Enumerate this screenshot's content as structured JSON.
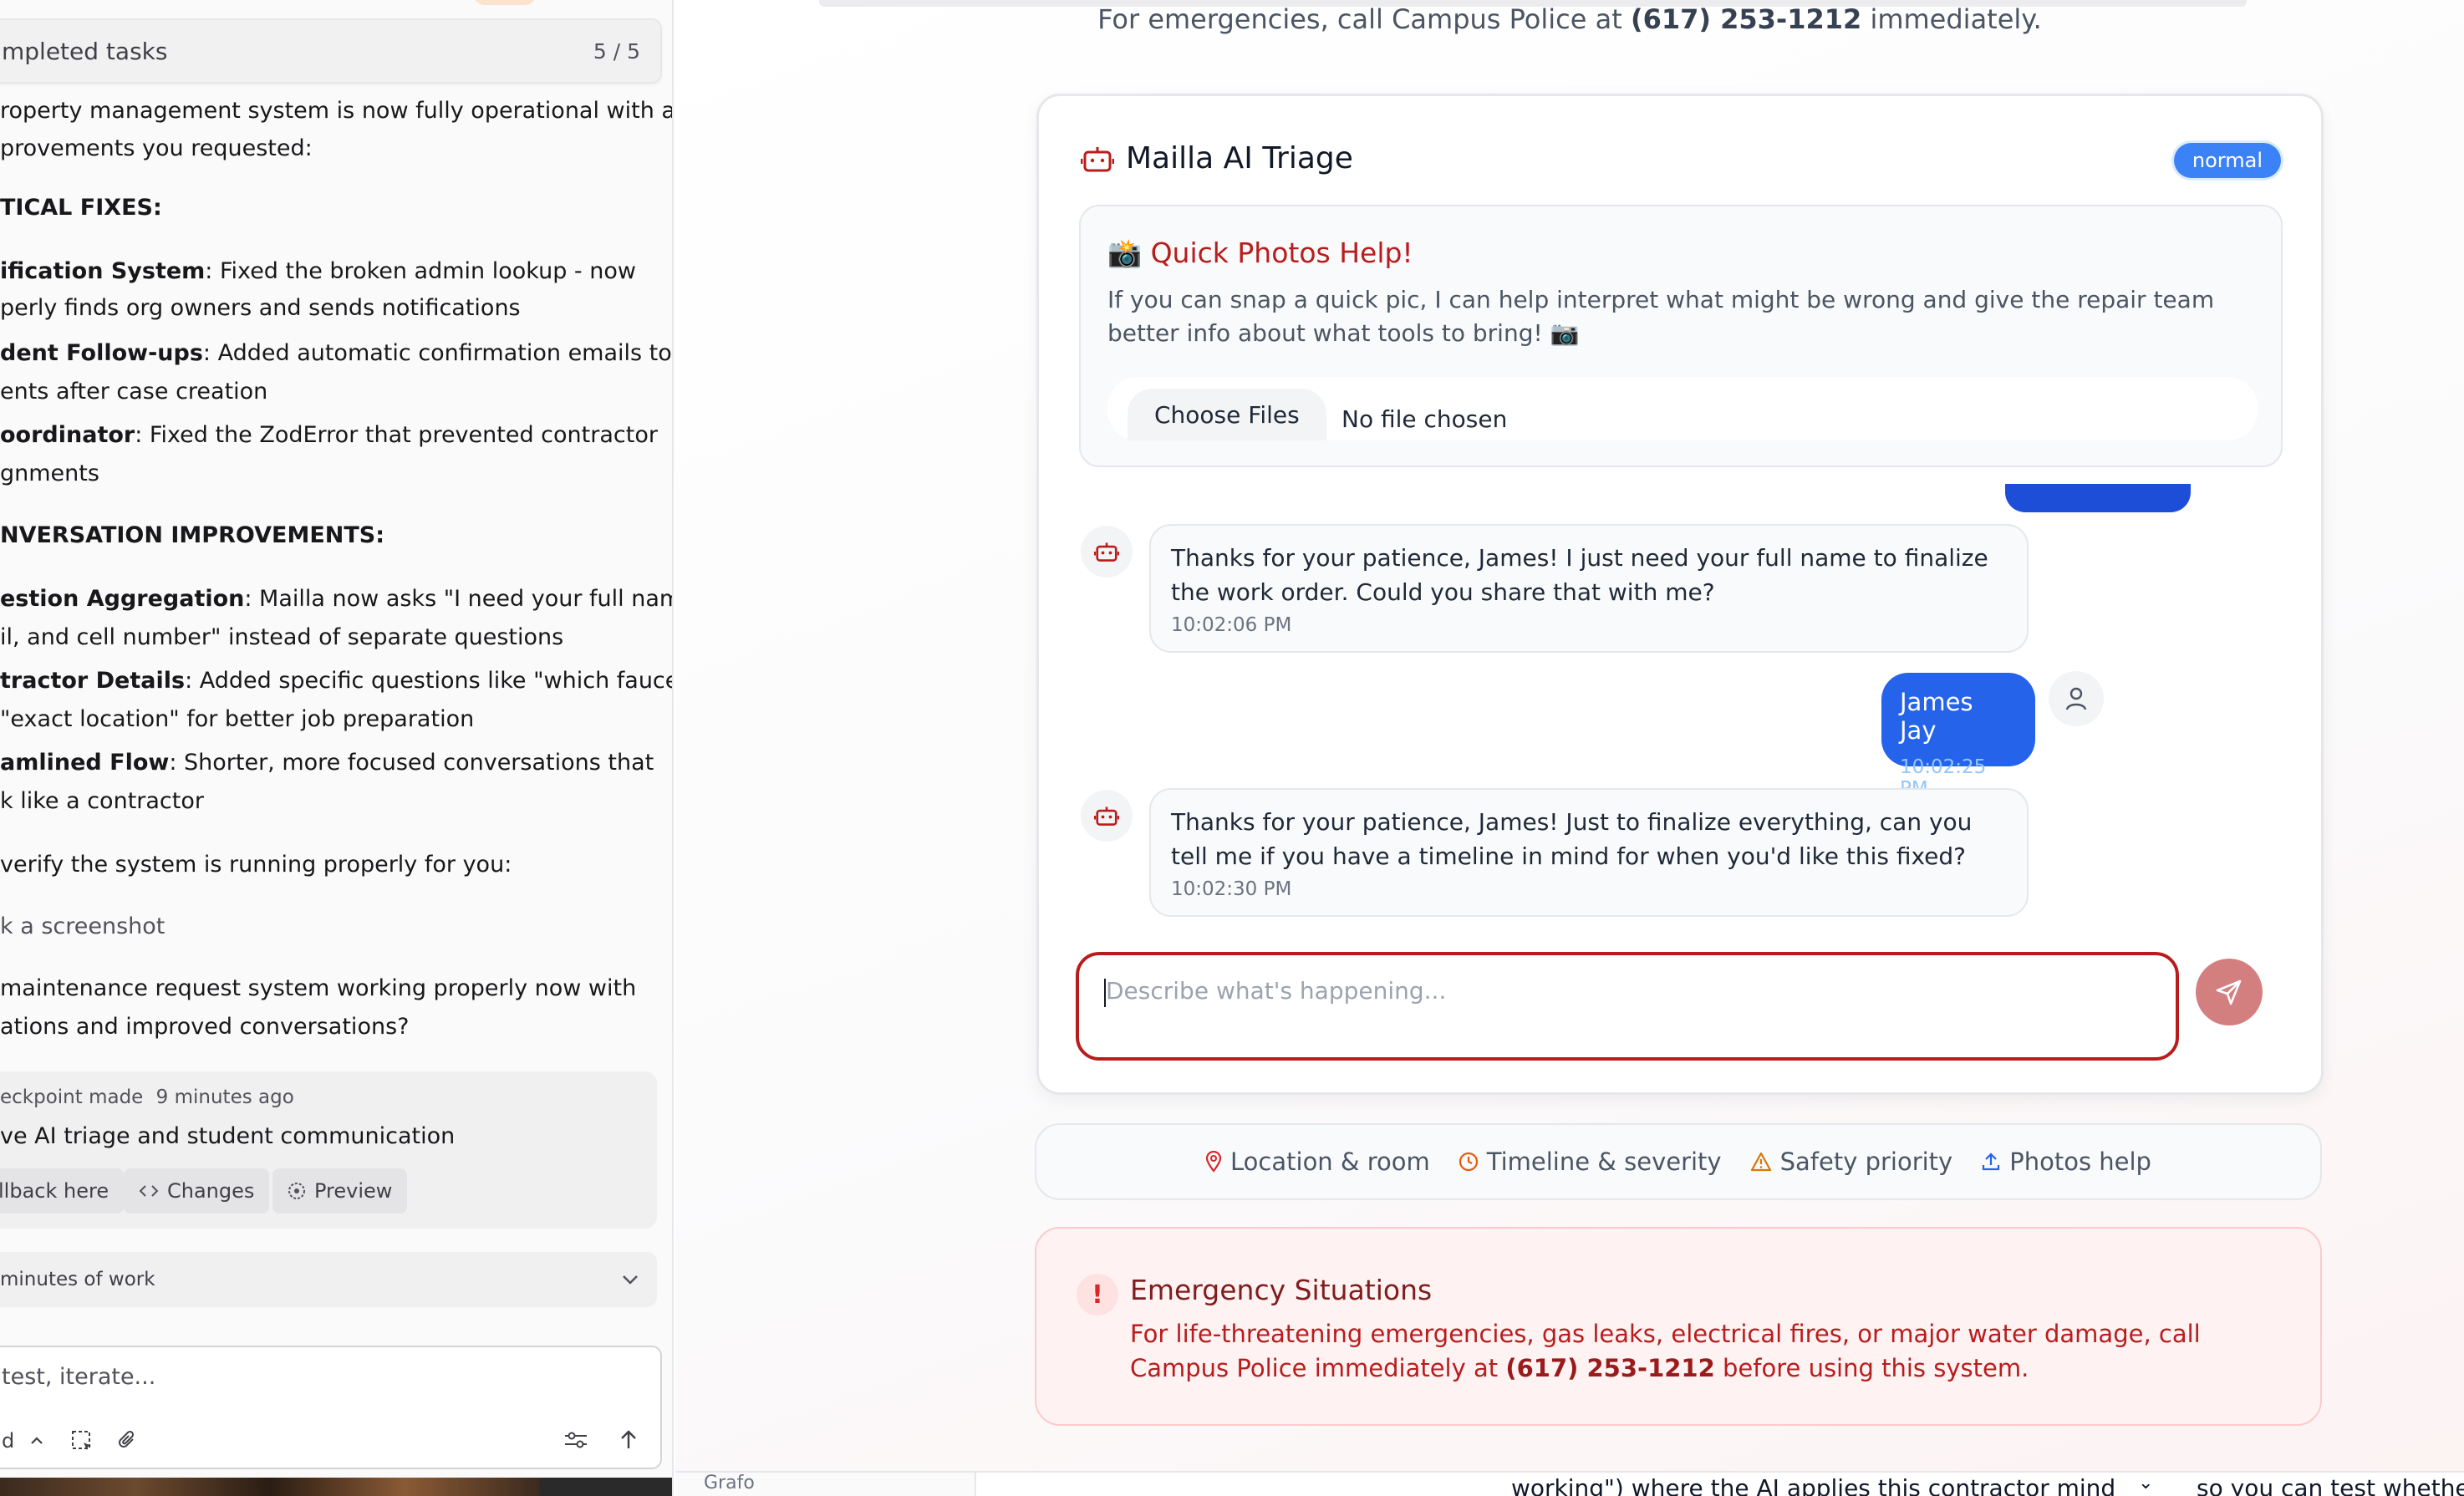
{
  "left_panel": {
    "tasks_header": {
      "title": "mpleted tasks",
      "count": "5 / 5"
    },
    "lines": [
      {
        "text": "roperty management system is now fully operational with all"
      },
      {
        "text": "provements you requested:"
      },
      {
        "bold": "TICAL FIXES:"
      },
      {
        "bold": "ification System",
        "text": ": Fixed the broken admin lookup - now"
      },
      {
        "text": "perly finds org owners and sends notifications"
      },
      {
        "bold": "dent Follow-ups",
        "text": ": Added automatic confirmation emails to"
      },
      {
        "text": "ents after case creation"
      },
      {
        "bold": "oordinator",
        "text": ": Fixed the ZodError that prevented contractor"
      },
      {
        "text": "gnments"
      },
      {
        "bold": "NVERSATION IMPROVEMENTS:"
      },
      {
        "bold": "estion Aggregation",
        "text": ": Mailla now asks \"I need your full name,"
      },
      {
        "text": "il, and cell number\" instead of separate questions"
      },
      {
        "bold": "tractor Details",
        "text": ": Added specific questions like \"which faucet\""
      },
      {
        "text": "\"exact location\" for better job preparation"
      },
      {
        "bold": "amlined Flow",
        "text": ": Shorter, more focused conversations that"
      },
      {
        "text": "k like a contractor"
      },
      {
        "text": " verify the system is running properly for you:"
      },
      {
        "text": "k a screenshot",
        "muted": true
      },
      {
        "text": "maintenance request system working properly now with"
      },
      {
        "text": "ations and improved conversations?"
      }
    ],
    "checkpoint": {
      "meta": "eckpoint made",
      "time_ago": "9 minutes ago",
      "title": "ve AI triage and student communication",
      "rollback_label": "llback here",
      "changes_label": "Changes",
      "preview_label": "Preview"
    },
    "work_summary": "minutes of work",
    "input": {
      "placeholder": "test, iterate...",
      "mode_label": "d"
    }
  },
  "right_area": {
    "emergency_top": {
      "prefix": "For emergencies, call Campus Police at ",
      "phone": "(617) 253-1212",
      "suffix": " immediately."
    },
    "triage": {
      "title": "Mailla AI Triage",
      "badge": "normal",
      "photos": {
        "heading": "📸 Quick Photos Help!",
        "description": "If you can snap a quick pic, I can help interpret what might be wrong and give the repair team better info about what tools to bring! 📷",
        "choose_label": "Choose Files",
        "no_file": "No file chosen"
      },
      "messages": [
        {
          "role": "bot",
          "text": "Thanks for your patience, James! I just need your full name to finalize the work order. Could you share that with me?",
          "time": "10:02:06 PM"
        },
        {
          "role": "user",
          "text": "James Jay",
          "time": "10:02:25 PM"
        },
        {
          "role": "bot",
          "text": "Thanks for your patience, James! Just to finalize everything, can you tell me if you have a timeline in mind for when you'd like this fixed?",
          "time": "10:02:30 PM"
        }
      ],
      "input_placeholder": "Describe what's happening..."
    },
    "topics": [
      {
        "icon": "map-pin-icon",
        "label": "Location & room",
        "color": "#dc2626"
      },
      {
        "icon": "clock-icon",
        "label": "Timeline & severity",
        "color": "#ea580c"
      },
      {
        "icon": "warning-icon",
        "label": "Safety priority",
        "color": "#d97706"
      },
      {
        "icon": "upload-icon",
        "label": "Photos help",
        "color": "#2563eb"
      }
    ],
    "emergency_card": {
      "title": "Emergency Situations",
      "text_prefix": "For life-threatening emergencies, gas leaks, electrical fires, or major water damage, call Campus Police immediately at ",
      "phone": "(617) 253-1212",
      "text_suffix": " before using this system."
    }
  },
  "bottom_strip": {
    "snippet_left": "Grafo",
    "text_mid": "working\") where the AI applies this contractor mind",
    "text_right": "so you can test whethe"
  },
  "colors": {
    "accent_red": "#b91c1c",
    "accent_blue": "#2563eb",
    "badge_blue": "#3b82f6"
  }
}
